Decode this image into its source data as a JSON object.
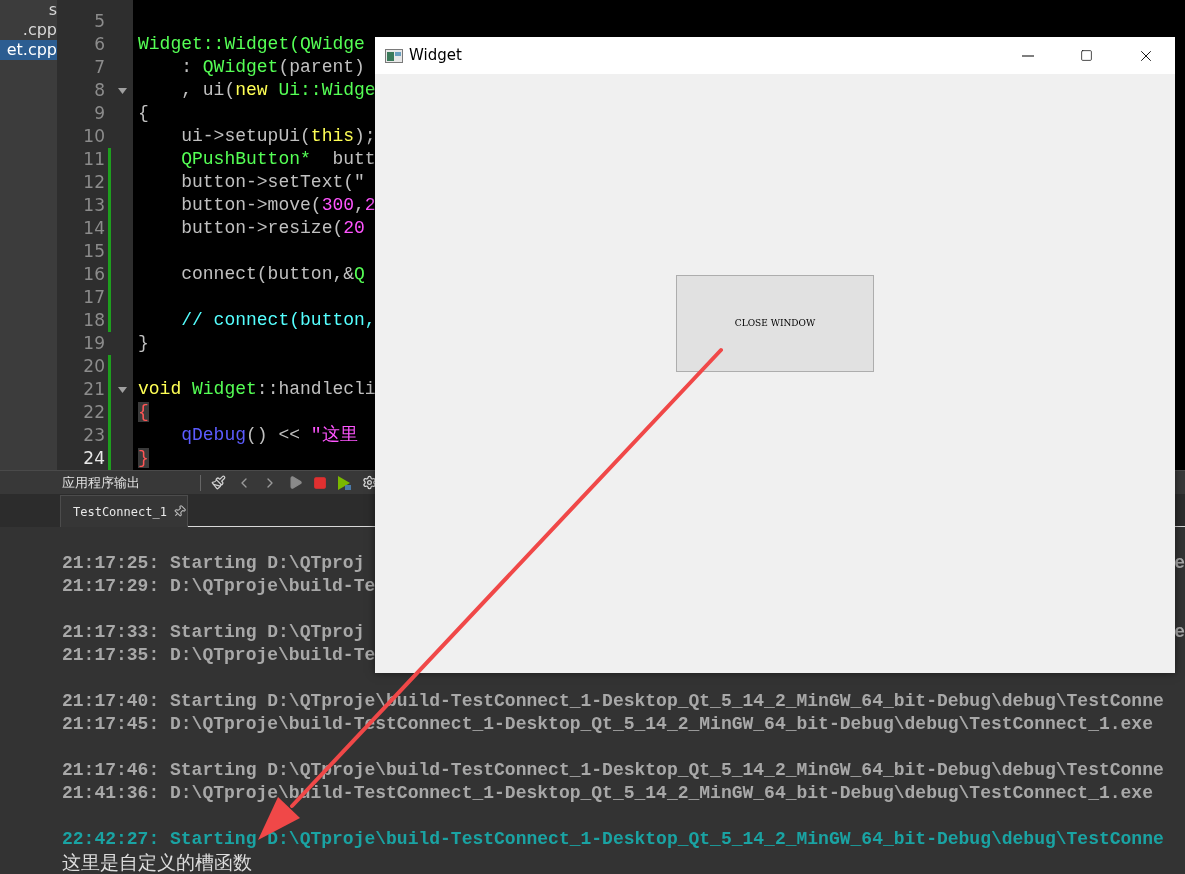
{
  "file_list": [
    {
      "label": "s",
      "selected": false
    },
    {
      "label": ".cpp",
      "selected": false
    },
    {
      "label": "et.cpp",
      "selected": true
    }
  ],
  "editor": {
    "lines": [
      {
        "number": "5",
        "modified": false,
        "foldable": false,
        "current": false
      },
      {
        "number": "6",
        "modified": false,
        "foldable": false,
        "current": false,
        "tokens": [
          {
            "kind": "type",
            "text": "Widget::Widget(QWidge"
          }
        ]
      },
      {
        "number": "7",
        "modified": false,
        "foldable": false,
        "current": false,
        "tokens": [
          {
            "kind": "plain",
            "text": "    : "
          },
          {
            "kind": "type",
            "text": "QWidget"
          },
          {
            "kind": "plain",
            "text": "(parent)"
          }
        ]
      },
      {
        "number": "8",
        "modified": false,
        "foldable": true,
        "current": false,
        "tokens": [
          {
            "kind": "plain",
            "text": "    , ui("
          },
          {
            "kind": "keyword",
            "text": "new"
          },
          {
            "kind": "type",
            "text": " Ui::Widge"
          }
        ]
      },
      {
        "number": "9",
        "modified": false,
        "foldable": false,
        "current": false,
        "tokens": [
          {
            "kind": "plain",
            "text": "{"
          }
        ]
      },
      {
        "number": "10",
        "modified": false,
        "foldable": false,
        "current": false,
        "tokens": [
          {
            "kind": "plain",
            "text": "    ui->setupUi("
          },
          {
            "kind": "keyword",
            "text": "this"
          },
          {
            "kind": "plain",
            "text": ");"
          }
        ]
      },
      {
        "number": "11",
        "modified": true,
        "foldable": false,
        "current": false,
        "tokens": [
          {
            "kind": "type",
            "text": "    QPushButton*"
          },
          {
            "kind": "plain",
            "text": "  butt"
          }
        ]
      },
      {
        "number": "12",
        "modified": true,
        "foldable": false,
        "current": false,
        "tokens": [
          {
            "kind": "plain",
            "text": "    button->setText(\""
          }
        ]
      },
      {
        "number": "13",
        "modified": true,
        "foldable": false,
        "current": false,
        "tokens": [
          {
            "kind": "plain",
            "text": "    button->move("
          },
          {
            "kind": "number",
            "text": "300"
          },
          {
            "kind": "plain",
            "text": ","
          },
          {
            "kind": "number",
            "text": "2"
          }
        ]
      },
      {
        "number": "14",
        "modified": true,
        "foldable": false,
        "current": false,
        "tokens": [
          {
            "kind": "plain",
            "text": "    button->resize("
          },
          {
            "kind": "number",
            "text": "20"
          }
        ]
      },
      {
        "number": "15",
        "modified": true,
        "foldable": false,
        "current": false
      },
      {
        "number": "16",
        "modified": true,
        "foldable": false,
        "current": false,
        "tokens": [
          {
            "kind": "plain",
            "text": "    connect(button,&"
          },
          {
            "kind": "type",
            "text": "Q"
          }
        ]
      },
      {
        "number": "17",
        "modified": true,
        "foldable": false,
        "current": false
      },
      {
        "number": "18",
        "modified": true,
        "foldable": false,
        "current": false,
        "tokens": [
          {
            "kind": "comment",
            "text": "    // connect(button,"
          }
        ]
      },
      {
        "number": "19",
        "modified": false,
        "foldable": false,
        "current": false,
        "tokens": [
          {
            "kind": "plain",
            "text": "}"
          }
        ]
      },
      {
        "number": "20",
        "modified": true,
        "foldable": false,
        "current": false
      },
      {
        "number": "21",
        "modified": true,
        "foldable": true,
        "current": false,
        "tokens": [
          {
            "kind": "keyword",
            "text": "void"
          },
          {
            "kind": "type",
            "text": " Widget"
          },
          {
            "kind": "plain",
            "text": "::handlecli"
          }
        ]
      },
      {
        "number": "22",
        "modified": true,
        "foldable": false,
        "current": false,
        "tokens": [
          {
            "kind": "brace-match",
            "text": "{"
          }
        ]
      },
      {
        "number": "23",
        "modified": true,
        "foldable": false,
        "current": false,
        "tokens": [
          {
            "kind": "function",
            "text": "    qDebug"
          },
          {
            "kind": "plain",
            "text": "() << "
          },
          {
            "kind": "string",
            "text": "\"这里"
          }
        ]
      },
      {
        "number": "24",
        "modified": true,
        "foldable": false,
        "current": true,
        "tokens": [
          {
            "kind": "brace-match",
            "text": "}"
          }
        ]
      }
    ]
  },
  "output_pane": {
    "title": "应用程序输出",
    "tabs": [
      {
        "label": "TestConnect_1",
        "selected": true
      }
    ],
    "runs": [
      {
        "lines": [
          {
            "kind": "log",
            "text": "21:17:25: Starting D:\\QTproj",
            "tail": "e"
          },
          {
            "kind": "log",
            "text": "21:17:29: D:\\QTproje\\build-Te"
          }
        ]
      },
      {
        "lines": [
          {
            "kind": "log",
            "text": "21:17:33: Starting D:\\QTproj",
            "tail": "e"
          },
          {
            "kind": "log",
            "text": "21:17:35: D:\\QTproje\\build-Te"
          }
        ]
      },
      {
        "lines": [
          {
            "kind": "log",
            "text": "21:17:40: Starting D:\\QTproje\\build-TestConnect_1-Desktop_Qt_5_14_2_MinGW_64_bit-Debug\\debug\\TestConne"
          },
          {
            "kind": "log",
            "text": "21:17:45: D:\\QTproje\\build-TestConnect_1-Desktop_Qt_5_14_2_MinGW_64_bit-Debug\\debug\\TestConnect_1.exe"
          }
        ]
      },
      {
        "lines": [
          {
            "kind": "log",
            "text": "21:17:46: Starting D:\\QTproje\\build-TestConnect_1-Desktop_Qt_5_14_2_MinGW_64_bit-Debug\\debug\\TestConne"
          },
          {
            "kind": "log",
            "text": "21:41:36: D:\\QTproje\\build-TestConnect_1-Desktop_Qt_5_14_2_MinGW_64_bit-Debug\\debug\\TestConnect_1.exe"
          }
        ]
      },
      {
        "lines": [
          {
            "kind": "current",
            "text": "22:42:27: Starting D:\\QTproje\\build-TestConnect_1-Desktop_Qt_5_14_2_MinGW_64_bit-Debug\\debug\\TestConne"
          },
          {
            "kind": "program",
            "text": "这里是自定义的槽函数"
          }
        ]
      }
    ]
  },
  "widget_window": {
    "title": "Widget",
    "button": {
      "label": "CLOSE WINDOW"
    }
  }
}
